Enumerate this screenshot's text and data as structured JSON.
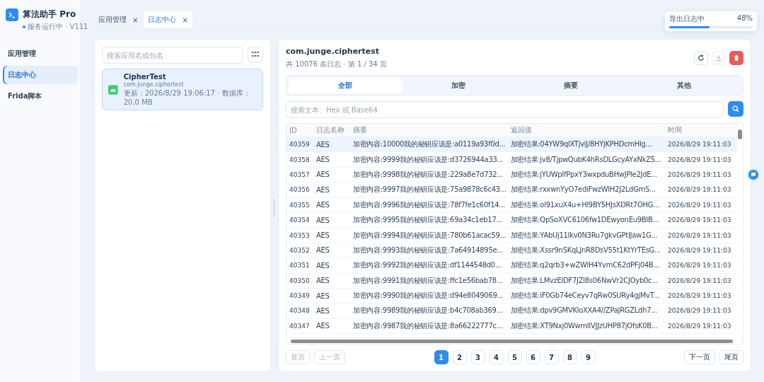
{
  "app": {
    "name": "算法助手 Pro",
    "status": "服务运行中 · V111",
    "online": true
  },
  "sidebar": {
    "items": [
      {
        "label": "应用管理",
        "selected": false
      },
      {
        "label": "日志中心",
        "selected": true
      },
      {
        "label": "Frida脚本",
        "selected": false
      }
    ]
  },
  "tabs": [
    {
      "label": "应用管理",
      "selected": false,
      "close": "×"
    },
    {
      "label": "日志中心",
      "selected": true,
      "close": "×"
    }
  ],
  "export_toast": {
    "label": "导出日志中",
    "percent": "48%",
    "level": 0.48
  },
  "apps_panel": {
    "search": {
      "placeholder": "搜索应用名或包名"
    },
    "apps": [
      {
        "name": "CipherTest",
        "package": "com.junge.ciphertest",
        "meta": "更新：2026/8/29 19:06:17 · 数据库：20.0 MB",
        "selected": true
      }
    ]
  },
  "log_panel": {
    "title": "com.junge.ciphertest",
    "summary": "共 10076 条日志 · 第 1 / 34 页",
    "actions": [
      {
        "kind": "refresh",
        "disabled": false
      },
      {
        "kind": "download",
        "disabled": true
      },
      {
        "kind": "delete",
        "disabled": false
      }
    ],
    "filters": [
      {
        "label": "全部",
        "selected": true
      },
      {
        "label": "加密",
        "selected": false
      },
      {
        "label": "摘要",
        "selected": false
      },
      {
        "label": "其他",
        "selected": false
      }
    ],
    "search": {
      "placeholder": "搜索文本、Hex 或 Base64"
    },
    "table": {
      "columns": [
        "ID",
        "日志名称",
        "摘要",
        "返回值",
        "时间"
      ],
      "rows": [
        {
          "selected": true,
          "cells": [
            "40359",
            "AES",
            "加密内容:10000我的秘钥应该是:a0119a93f0d...",
            "加密结果:04YW9qlXTjviJ/8HYjKPHDcmHlg...",
            "2026/8/29 19:11:03"
          ]
        },
        {
          "selected": false,
          "cells": [
            "40358",
            "AES",
            "加密内容:9999我的秘钥应该是:d3726944a33...",
            "加密结果:jv8/TjpwQubK4hRsDLGcyAYxNkZ5...",
            "2026/8/29 19:11:03"
          ]
        },
        {
          "selected": false,
          "cells": [
            "40357",
            "AES",
            "加密内容:9998我的秘钥应该是:229a8e7d732...",
            "加密结果:jYUWpIfPpxY3wxpduBHwJPle2JdE...",
            "2026/8/29 19:11:03"
          ]
        },
        {
          "selected": false,
          "cells": [
            "40356",
            "AES",
            "加密内容:9997我的秘钥应该是:75a9878c6c43...",
            "加密结果:rxxwnYyO7ediFwzWlH2J2LdGmS...",
            "2026/8/29 19:11:03"
          ]
        },
        {
          "selected": false,
          "cells": [
            "40355",
            "AES",
            "加密内容:9996我的秘钥应该是:78f7fe1c60f14...",
            "加密结果:ol91xuX4u+Hl9BY5HJsXDRt7OHG...",
            "2026/8/29 19:11:03"
          ]
        },
        {
          "selected": false,
          "cells": [
            "40354",
            "AES",
            "加密内容:9995我的秘钥应该是:69a34c1eb17...",
            "加密结果:QpSoXVC6106fw1DEwyonEu9BIB...",
            "2026/8/29 19:11:03"
          ]
        },
        {
          "selected": false,
          "cells": [
            "40353",
            "AES",
            "加密内容:9994我的秘钥应该是:780b61acac59...",
            "加密结果:YAbUj11Ikv0N3Ru7gkvGPtIJaw1G...",
            "2026/8/29 19:11:03"
          ]
        },
        {
          "selected": false,
          "cells": [
            "40352",
            "AES",
            "加密内容:9993我的秘钥应该是:7a64914895e...",
            "加密结果:Xssr9nSKqLJnR8DsV55t1KtYrTEsG...",
            "2026/8/29 19:11:03"
          ]
        },
        {
          "selected": false,
          "cells": [
            "40351",
            "AES",
            "加密内容:9992我的秘钥应该是:df1144548d0...",
            "加密结果:q2qrb3+wZWlH4YvmC62dPFj04B...",
            "2026/8/29 19:11:03"
          ]
        },
        {
          "selected": false,
          "cells": [
            "40350",
            "AES",
            "加密内容:9991我的秘钥应该是:ffc1e56bab78...",
            "加密结果:LMvzEIDF7JZl8s06NwVr2CJOyb0c...",
            "2026/8/29 19:11:03"
          ]
        },
        {
          "selected": false,
          "cells": [
            "40349",
            "AES",
            "加密内容:9990我的秘钥应该是:d94e8049069...",
            "加密结果:iF0Gb74eCeyv7qRw0SURy4gjMvT...",
            "2026/8/29 19:11:03"
          ]
        },
        {
          "selected": false,
          "cells": [
            "40348",
            "AES",
            "加密内容:9989我的秘钥应该是:b4c708ab369...",
            "加密结果:dpv9GMVKloXXA4//ZPaJRGZLdh7...",
            "2026/8/29 19:11:03"
          ]
        },
        {
          "selected": false,
          "cells": [
            "40347",
            "AES",
            "加密内容:9987我的秘钥应该是:8a66222777c...",
            "加密结果:XT9Nxj0WwmlIVJJzUHP87jOfsK0B...",
            "2026/8/29 19:11:03"
          ]
        }
      ]
    },
    "pagination": {
      "first": {
        "label": "首页",
        "disabled": true
      },
      "prev": {
        "label": "上一页",
        "disabled": true
      },
      "pages": [
        {
          "label": "1",
          "selected": true
        },
        {
          "label": "2",
          "selected": false
        },
        {
          "label": "3",
          "selected": false
        },
        {
          "label": "4",
          "selected": false
        },
        {
          "label": "5",
          "selected": false
        },
        {
          "label": "6",
          "selected": false
        },
        {
          "label": "7",
          "selected": false
        },
        {
          "label": "8",
          "selected": false
        },
        {
          "label": "9",
          "selected": false
        }
      ],
      "next": {
        "label": "下一页",
        "disabled": false
      },
      "last": {
        "label": "尾页",
        "disabled": false
      }
    }
  }
}
